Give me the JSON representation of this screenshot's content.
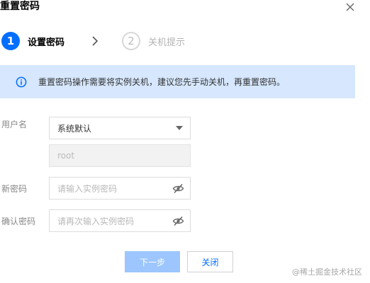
{
  "dialog": {
    "title": "重置密码"
  },
  "steps": [
    {
      "number": "1",
      "label": "设置密码",
      "state": "active"
    },
    {
      "number": "2",
      "label": "关机提示",
      "state": "inactive"
    }
  ],
  "banner": {
    "text": "重置密码操作需要将实例关机，建议您先手动关机，再重置密码。",
    "icon": "info-icon"
  },
  "form": {
    "username": {
      "label": "用户名",
      "selected": "系统默认",
      "value": "root"
    },
    "new_password": {
      "label": "新密码",
      "placeholder": "请输入实例密码"
    },
    "confirm_password": {
      "label": "确认密码",
      "placeholder": "请再次输入实例密码"
    }
  },
  "buttons": {
    "next": "下一步",
    "close": "关闭"
  },
  "watermark": "@稀土掘金技术社区",
  "colors": {
    "primary": "#006eff",
    "banner_bg": "#d6e7fe",
    "disabled_primary": "#9cc6fd"
  }
}
